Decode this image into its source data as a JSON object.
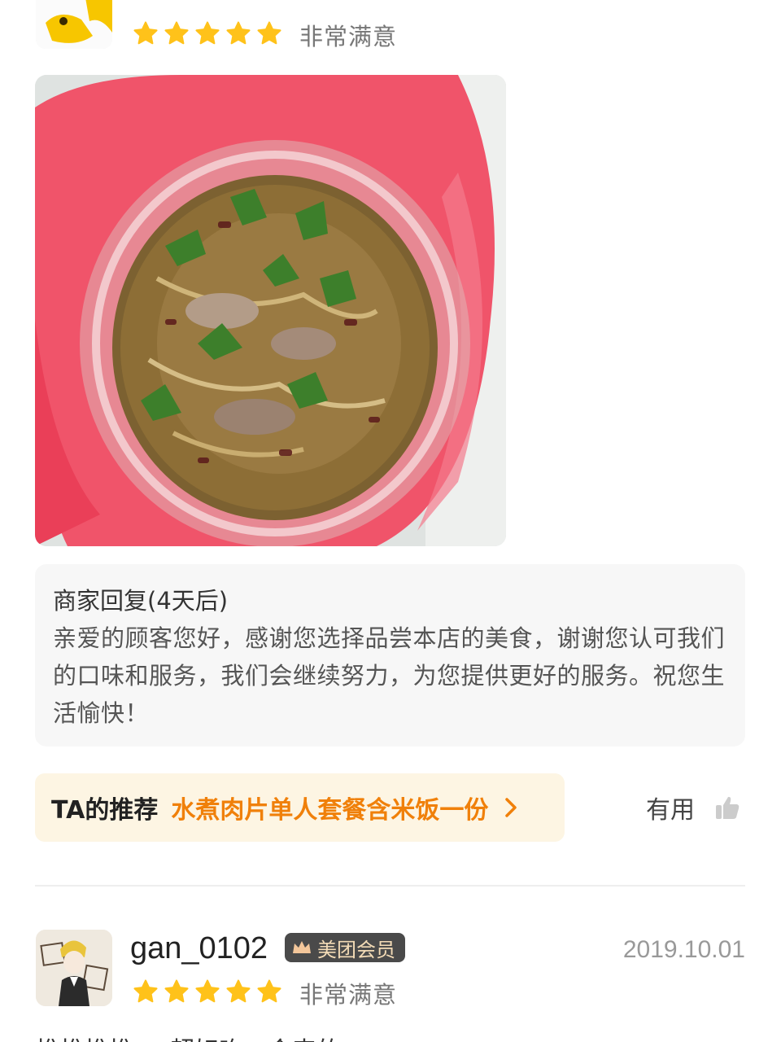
{
  "top_review": {
    "rating_text": "非常满意",
    "stars": 5
  },
  "merchant_reply": {
    "title": "商家回复(4天后)",
    "text": "亲爱的顾客您好，感谢您选择品尝本店的美食，谢谢您认可我们的口味和服务，我们会继续努力，为您提供更好的服务。祝您生活愉快！"
  },
  "recommendation": {
    "label": "TA的推荐",
    "dish": "水煮肉片单人套餐含米饭一份"
  },
  "useful_label": "有用",
  "second_review": {
    "username": "gan_0102",
    "badge": "美团会员",
    "date": "2019.10.01",
    "rating_text": "非常满意",
    "stars": 5,
    "text_preview": "推推推推，，超好吃，会来的"
  },
  "colors": {
    "star": "#ffc21a",
    "accent_orange": "#f0800a",
    "pill_bg": "#fdf5e3",
    "badge_bg": "#4a4a4a",
    "badge_text": "#f3dbb6"
  }
}
